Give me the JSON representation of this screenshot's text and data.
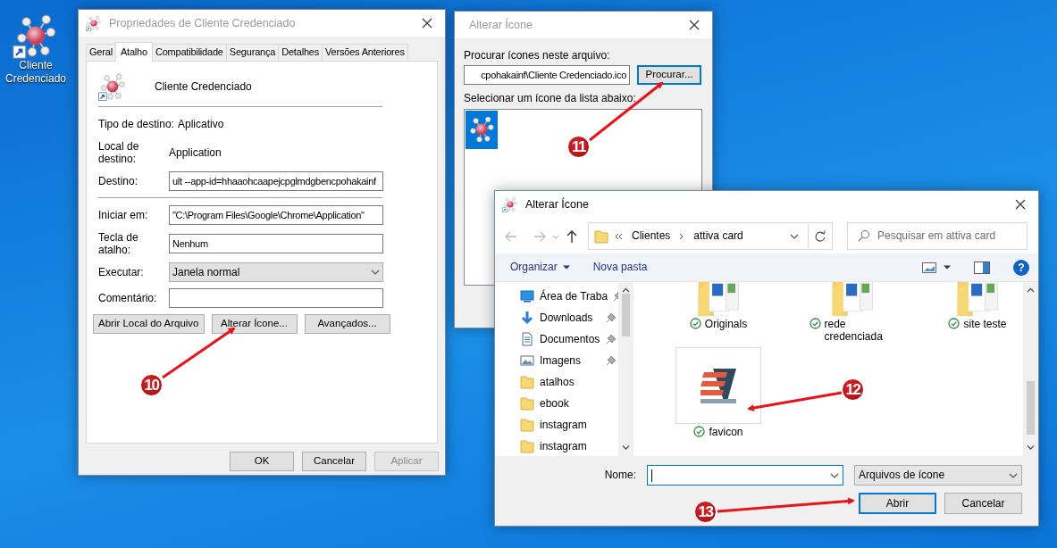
{
  "desktop_icon": {
    "label": "Cliente Credenciado"
  },
  "properties_window": {
    "title": "Propriedades de Cliente Credenciado",
    "tabs": [
      {
        "label": "Geral",
        "selected": false
      },
      {
        "label": "Atalho",
        "selected": true
      },
      {
        "label": "Compatibilidade",
        "selected": false
      },
      {
        "label": "Segurança",
        "selected": false
      },
      {
        "label": "Detalhes",
        "selected": false
      },
      {
        "label": "Versões Anteriores",
        "selected": false
      }
    ],
    "shortcut_name": "Cliente Credenciado",
    "sections": [
      [
        {
          "kind": "static",
          "label": "Tipo de destino:",
          "value": "Aplicativo"
        },
        {
          "kind": "static",
          "label": "Local de\ndestino:",
          "value": "Application"
        },
        {
          "kind": "input",
          "label": "Destino:",
          "value": "ult --app-id=hhaaohcaapejcpglmdgbencpohakainf"
        }
      ],
      [
        {
          "kind": "input",
          "label": "Iniciar em:",
          "value": "\"C:\\Program Files\\Google\\Chrome\\Application\""
        },
        {
          "kind": "input",
          "label": "Tecla de\natalho:",
          "value": "Nenhum"
        },
        {
          "kind": "select",
          "label": "Executar:",
          "value": "Janela normal"
        },
        {
          "kind": "input",
          "label": "Comentário:"
        }
      ]
    ],
    "action_buttons": [
      "Abrir Local do Arquivo",
      "Alterar Ícone...",
      "Avançados..."
    ],
    "footer_buttons": [
      {
        "label": "OK",
        "disabled": false
      },
      {
        "label": "Cancelar",
        "disabled": false
      },
      {
        "label": "Aplicar",
        "disabled": true
      }
    ]
  },
  "icon_window": {
    "title": "Alterar Ícone",
    "file_label": "Procurar ícones neste arquivo:",
    "file_value": "cpohakainf\\Cliente Credenciado.ico",
    "browse_button": {
      "label": "Procurar...",
      "focused": true
    },
    "list_label": "Selecionar um ícone da lista abaixo:",
    "icons": [
      {
        "selected": true
      }
    ]
  },
  "file_dialog": {
    "title": "Alterar Ícone",
    "breadcrumb": [
      "Clientes",
      "attiva card"
    ],
    "search_placeholder": "Pesquisar em attiva card",
    "toolbar": {
      "organize": "Organizar",
      "new_folder": "Nova pasta",
      "help": "?"
    },
    "nav_items": [
      {
        "label": "Área de Traba",
        "kind": "desktop",
        "pinned": true
      },
      {
        "label": "Downloads",
        "kind": "download",
        "pinned": true
      },
      {
        "label": "Documentos",
        "kind": "document",
        "pinned": true
      },
      {
        "label": "Imagens",
        "kind": "image",
        "pinned": true
      },
      {
        "label": "atalhos",
        "kind": "folder",
        "pinned": false
      },
      {
        "label": "ebook",
        "kind": "folder",
        "pinned": false
      },
      {
        "label": "instagram",
        "kind": "folder",
        "pinned": false
      },
      {
        "label": "instagram",
        "kind": "folder",
        "pinned": false
      }
    ],
    "files": [
      {
        "name": "Originals",
        "kind": "folder",
        "synced": true
      },
      {
        "name": "rede credenciada",
        "kind": "folder",
        "synced": true
      },
      {
        "name": "site teste",
        "kind": "folder",
        "synced": true
      },
      {
        "name": "favicon",
        "kind": "image",
        "synced": true
      }
    ],
    "name_label": "Nome:",
    "file_type": "Arquivos de ícone",
    "buttons": [
      {
        "label": "Abrir",
        "default": true
      },
      {
        "label": "Cancelar",
        "default": false
      }
    ]
  },
  "annotations": [
    {
      "label": "10"
    },
    {
      "label": "11"
    },
    {
      "label": "12"
    },
    {
      "label": "13"
    }
  ]
}
